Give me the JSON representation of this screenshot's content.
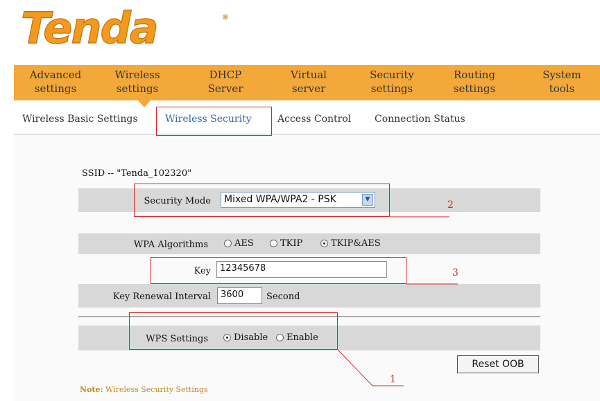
{
  "brand": {
    "logo_text": "Tenda",
    "logo_color": "#f39a1e"
  },
  "nav": {
    "items": [
      {
        "line1": "Advanced",
        "line2": "settings"
      },
      {
        "line1": "Wireless",
        "line2": "settings"
      },
      {
        "line1": "DHCP",
        "line2": "Server"
      },
      {
        "line1": "Virtual",
        "line2": "server"
      },
      {
        "line1": "Security",
        "line2": "settings"
      },
      {
        "line1": "Routing",
        "line2": "settings"
      },
      {
        "line1": "System",
        "line2": "tools"
      }
    ],
    "active_index": 1,
    "color": "#f3a83a"
  },
  "subnav": {
    "items": [
      "Wireless Basic Settings",
      "Wireless Security",
      "Access Control",
      "Connection Status"
    ],
    "active_index": 1
  },
  "form": {
    "ssid_text": "SSID -- \"Tenda_102320\"",
    "security_mode": {
      "label": "Security Mode",
      "value": "Mixed WPA/WPA2 - PSK"
    },
    "wpa_algorithms": {
      "label": "WPA Algorithms",
      "options": [
        "AES",
        "TKIP",
        "TKIP&AES"
      ],
      "selected": "TKIP&AES"
    },
    "key": {
      "label": "Key",
      "value": "12345678"
    },
    "key_renewal": {
      "label": "Key Renewal Interval",
      "value": "3600",
      "unit": "Second"
    },
    "wps": {
      "label": "WPS Settings",
      "options": [
        "Disable",
        "Enable"
      ],
      "selected": "Disable"
    },
    "reset_button": "Reset OOB"
  },
  "note": {
    "prefix": "Note:",
    "text": "Wireless Security Settings"
  },
  "annotations": {
    "num1": "1",
    "num2": "2",
    "num3": "3",
    "color": "#dd2222"
  }
}
